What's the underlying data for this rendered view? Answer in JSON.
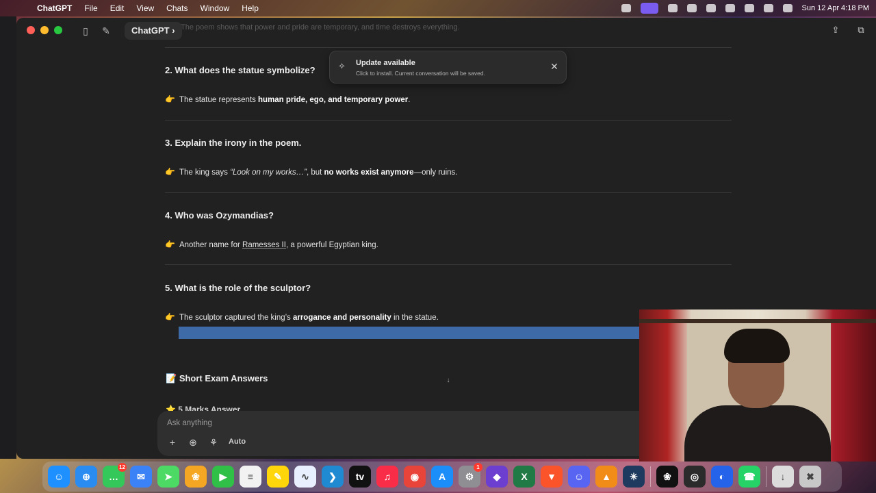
{
  "menubar": {
    "app_name": "ChatGPT",
    "items": [
      "File",
      "Edit",
      "View",
      "Chats",
      "Window",
      "Help"
    ],
    "clock": "Sun 12 Apr  4:18 PM"
  },
  "titlebar": {
    "model_label": "ChatGPT",
    "ghost_text": "The poem shows that power and pride are temporary, and time destroys everything."
  },
  "toast": {
    "title": "Update available",
    "subtitle": "Click to install. Current conversation will be saved."
  },
  "qa": [
    {
      "question": "2. What does the statue symbolize?",
      "answer_pre": "The statue represents ",
      "answer_bold": "human pride, ego, and temporary power",
      "answer_post": "."
    },
    {
      "question": "3. Explain the irony in the poem.",
      "answer_pre": "The king says ",
      "answer_italic": "“Look on my works…”",
      "answer_mid": ", but ",
      "answer_bold": "no works exist anymore",
      "answer_post": "—only ruins."
    },
    {
      "question": "4. Who was Ozymandias?",
      "answer_pre": "Another name for ",
      "answer_link": "Ramesses II",
      "answer_post": ", a powerful Egyptian king."
    },
    {
      "question": "5. What is the role of the sculptor?",
      "answer_pre": "The sculptor captured the king’s ",
      "answer_bold": "arrogance and personality",
      "answer_post": " in the statue."
    }
  ],
  "section_heading": "Short Exam Answers",
  "subsection_heading": "5 Marks Answer",
  "composer": {
    "placeholder": "Ask anything",
    "auto_label": "Auto"
  },
  "dock": {
    "apps": [
      {
        "name": "finder",
        "color": "#1e90ff",
        "glyph": "☺"
      },
      {
        "name": "safari",
        "color": "#2a8cf0",
        "glyph": "⊕"
      },
      {
        "name": "messages",
        "color": "#34c759",
        "glyph": "…",
        "badge": "12"
      },
      {
        "name": "mail",
        "color": "#3b82f6",
        "glyph": "✉"
      },
      {
        "name": "maps",
        "color": "#4cd964",
        "glyph": "➤"
      },
      {
        "name": "photos",
        "color": "#f5a623",
        "glyph": "❀"
      },
      {
        "name": "facetime",
        "color": "#30c048",
        "glyph": "▶"
      },
      {
        "name": "reminders",
        "color": "#f2f2f2",
        "glyph": "≡"
      },
      {
        "name": "notes",
        "color": "#ffd60a",
        "glyph": "✎"
      },
      {
        "name": "freeform",
        "color": "#e8f0ff",
        "glyph": "∿"
      },
      {
        "name": "vscode",
        "color": "#1f8ad2",
        "glyph": "❯"
      },
      {
        "name": "apple-tv",
        "color": "#111111",
        "glyph": "tv"
      },
      {
        "name": "music",
        "color": "#fa2d48",
        "glyph": "♫"
      },
      {
        "name": "chrome",
        "color": "#e9443a",
        "glyph": "◉"
      },
      {
        "name": "app-store",
        "color": "#1c8ef9",
        "glyph": "A"
      },
      {
        "name": "system-settings",
        "color": "#8e8e93",
        "glyph": "⚙",
        "badge": "1"
      },
      {
        "name": "obsidian",
        "color": "#6c3fd1",
        "glyph": "◆"
      },
      {
        "name": "excel",
        "color": "#1f7a45",
        "glyph": "X"
      },
      {
        "name": "brave",
        "color": "#fb542b",
        "glyph": "▼"
      },
      {
        "name": "discord",
        "color": "#5865f2",
        "glyph": "☺"
      },
      {
        "name": "vlc",
        "color": "#f28c18",
        "glyph": "▲"
      },
      {
        "name": "perplexity",
        "color": "#1e3a5f",
        "glyph": "✳"
      },
      {
        "name": "chatgpt",
        "color": "#111111",
        "glyph": "❀"
      },
      {
        "name": "obs",
        "color": "#2b2b2b",
        "glyph": "◎"
      },
      {
        "name": "ai-app",
        "color": "#2563eb",
        "glyph": "◐"
      },
      {
        "name": "whatsapp",
        "color": "#25d366",
        "glyph": "☎"
      },
      {
        "name": "downloads-folder",
        "color": "#dcdcdc",
        "glyph": "↓"
      },
      {
        "name": "trash",
        "color": "#c8c8c8",
        "glyph": "✖"
      }
    ]
  }
}
